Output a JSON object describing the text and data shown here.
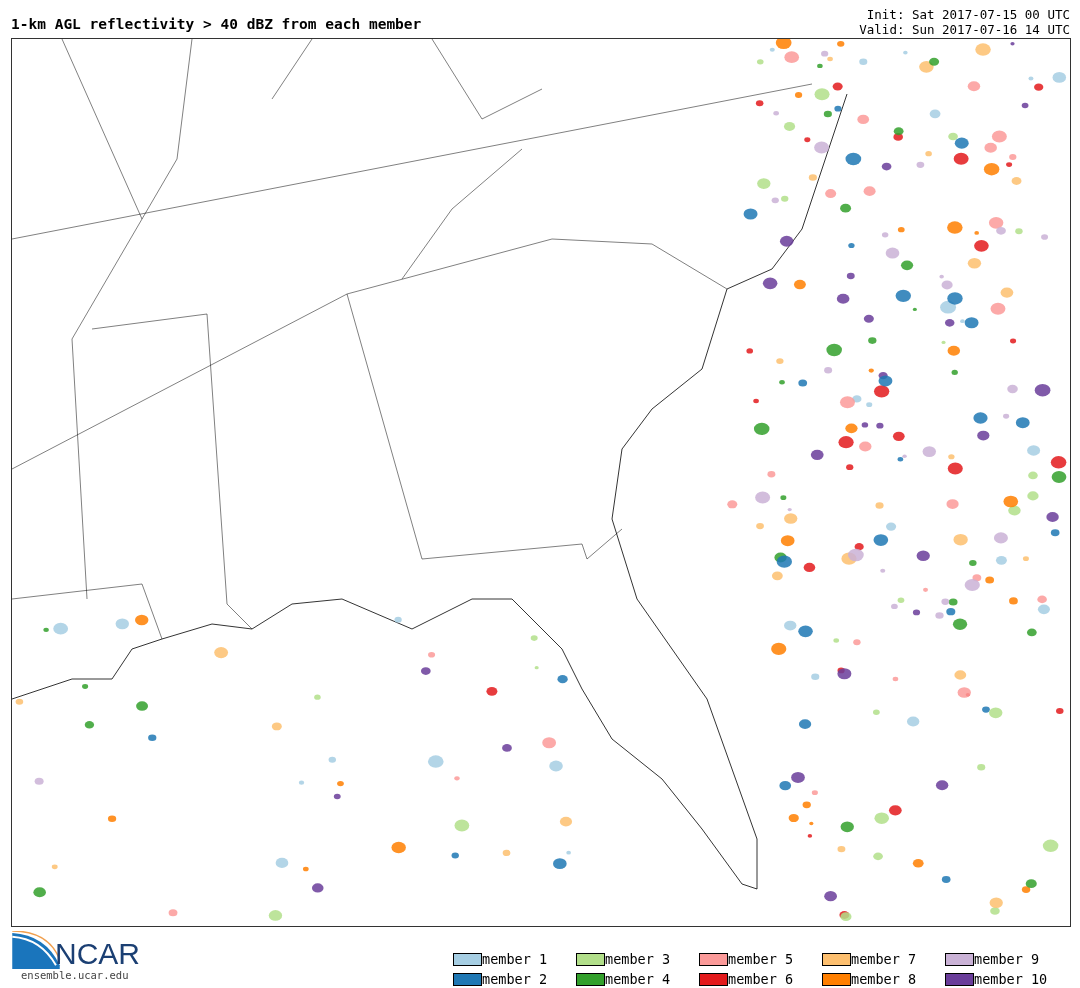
{
  "header": {
    "title": "1-km AGL reflectivity > 40 dBZ from each member",
    "init": "Init: Sat 2017-07-15 00 UTC",
    "valid": "Valid: Sun 2017-07-16 14 UTC"
  },
  "logo": {
    "name": "NCAR",
    "url": "ensemble.ucar.edu"
  },
  "legend": [
    {
      "label": "member 1",
      "color": "#a6cee3"
    },
    {
      "label": "member 3",
      "color": "#b2df8a"
    },
    {
      "label": "member 5",
      "color": "#fb9a99"
    },
    {
      "label": "member 7",
      "color": "#fdbf6f"
    },
    {
      "label": "member 9",
      "color": "#cab2d6"
    },
    {
      "label": "member 2",
      "color": "#1f78b4"
    },
    {
      "label": "member 4",
      "color": "#33a02c"
    },
    {
      "label": "member 6",
      "color": "#e31a1c"
    },
    {
      "label": "member 8",
      "color": "#ff7f00"
    },
    {
      "label": "member 10",
      "color": "#6a3d9a"
    }
  ]
}
